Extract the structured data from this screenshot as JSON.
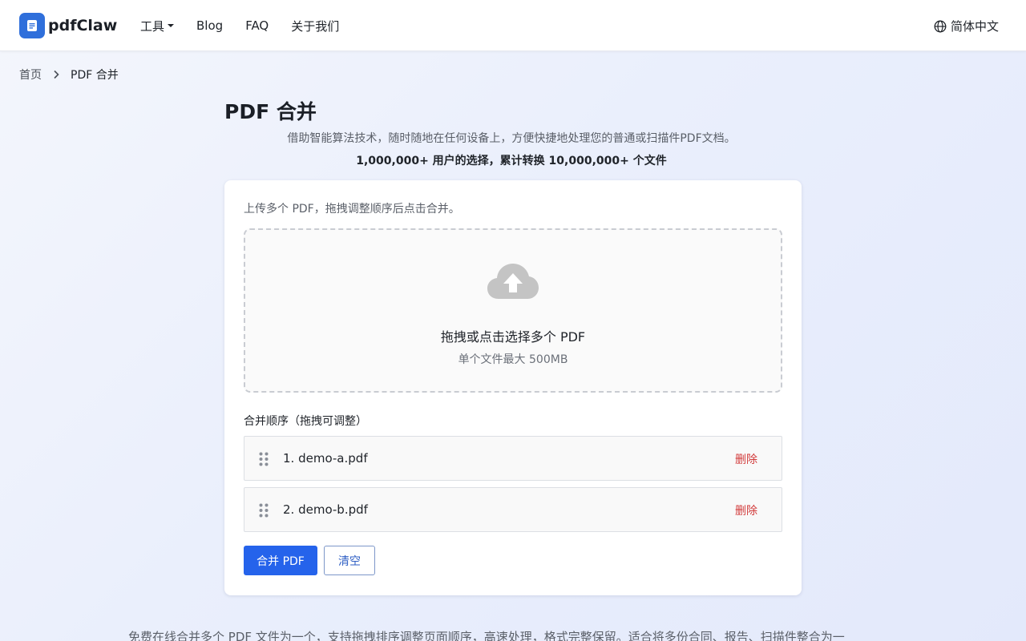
{
  "brand": {
    "name": "pdfClaw"
  },
  "nav": {
    "tools": "工具",
    "blog": "Blog",
    "faq": "FAQ",
    "about": "关于我们"
  },
  "lang": {
    "label": "简体中文"
  },
  "breadcrumb": {
    "home": "首页",
    "current": "PDF 合并"
  },
  "page": {
    "title": "PDF 合并",
    "subtitle": "借助智能算法技术，随时随地在任何设备上，方便快捷地处理您的普通或扫描件PDF文档。",
    "stats": "1,000,000+ 用户的选择，累计转换 10,000,000+ 个文件"
  },
  "card": {
    "hint": "上传多个 PDF，拖拽调整顺序后点击合并。",
    "dropzone": {
      "main": "拖拽或点击选择多个 PDF",
      "sub": "单个文件最大 500MB"
    },
    "order_label": "合并顺序（拖拽可调整）",
    "files": [
      {
        "name": "1. demo-a.pdf",
        "delete": "删除"
      },
      {
        "name": "2. demo-b.pdf",
        "delete": "删除"
      }
    ],
    "merge_button": "合并 PDF",
    "clear_button": "清空"
  },
  "footer": {
    "description": "免费在线合并多个 PDF 文件为一个，支持拖拽排序调整页面顺序，高速处理，格式完整保留。适合将多份合同、报告、扫描件整合为一"
  },
  "colors": {
    "brand": "#2f6fdb",
    "primary_button": "#2563eb",
    "delete": "#d23a3a"
  }
}
